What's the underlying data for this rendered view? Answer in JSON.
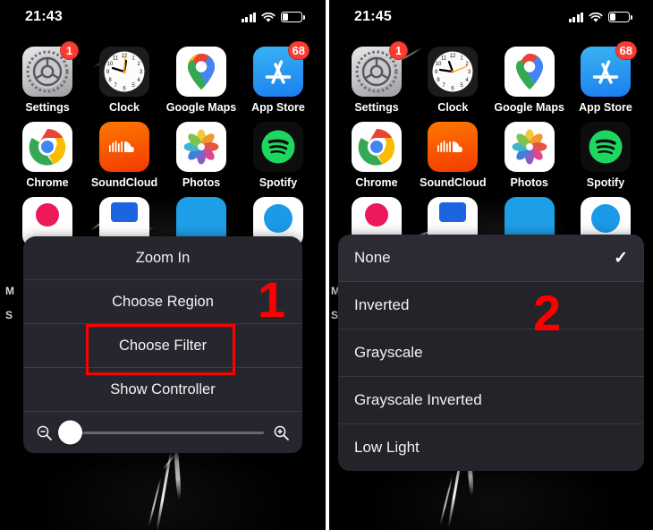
{
  "panels": [
    {
      "id": "left",
      "status": {
        "time": "21:43",
        "cellular_icon": "cellular-bars-icon",
        "wifi_icon": "wifi-icon",
        "battery_icon": "battery-low-icon"
      },
      "apps_row1": [
        {
          "label": "Settings",
          "icon": "settings-gear-icon",
          "badge": "1"
        },
        {
          "label": "Clock",
          "icon": "clock-icon",
          "badge": ""
        },
        {
          "label": "Google Maps",
          "icon": "google-maps-pin-icon",
          "badge": ""
        },
        {
          "label": "App Store",
          "icon": "app-store-icon",
          "badge": "68"
        }
      ],
      "apps_row2": [
        {
          "label": "Chrome",
          "icon": "chrome-icon",
          "badge": ""
        },
        {
          "label": "SoundCloud",
          "icon": "soundcloud-icon",
          "badge": ""
        },
        {
          "label": "Photos",
          "icon": "photos-icon",
          "badge": ""
        },
        {
          "label": "Spotify",
          "icon": "spotify-icon",
          "badge": ""
        }
      ],
      "peek_labels": [
        "M",
        "S"
      ],
      "menu": {
        "items": [
          {
            "label": "Zoom In",
            "highlighted": false
          },
          {
            "label": "Choose Region",
            "highlighted": false
          },
          {
            "label": "Choose Filter",
            "highlighted": true
          },
          {
            "label": "Show Controller",
            "highlighted": false
          }
        ],
        "slider": {
          "zoom_out_icon": "magnifier-minus-icon",
          "zoom_in_icon": "magnifier-plus-icon",
          "value_percent": 0
        }
      },
      "annotation": {
        "number": "1",
        "color": "#ff0000"
      }
    },
    {
      "id": "right",
      "status": {
        "time": "21:45",
        "cellular_icon": "cellular-bars-icon",
        "wifi_icon": "wifi-icon",
        "battery_icon": "battery-low-icon"
      },
      "apps_row1": [
        {
          "label": "Settings",
          "icon": "settings-gear-icon",
          "badge": "1"
        },
        {
          "label": "Clock",
          "icon": "clock-icon",
          "badge": ""
        },
        {
          "label": "Google Maps",
          "icon": "google-maps-pin-icon",
          "badge": ""
        },
        {
          "label": "App Store",
          "icon": "app-store-icon",
          "badge": "68"
        }
      ],
      "apps_row2": [
        {
          "label": "Chrome",
          "icon": "chrome-icon",
          "badge": ""
        },
        {
          "label": "SoundCloud",
          "icon": "soundcloud-icon",
          "badge": ""
        },
        {
          "label": "Photos",
          "icon": "photos-icon",
          "badge": ""
        },
        {
          "label": "Spotify",
          "icon": "spotify-icon",
          "badge": ""
        }
      ],
      "peek_labels": [
        "M",
        "S"
      ],
      "filter_menu": {
        "items": [
          {
            "label": "None",
            "selected": true,
            "check": "✓"
          },
          {
            "label": "Inverted",
            "selected": false,
            "check": ""
          },
          {
            "label": "Grayscale",
            "selected": false,
            "check": ""
          },
          {
            "label": "Grayscale Inverted",
            "selected": false,
            "check": ""
          },
          {
            "label": "Low Light",
            "selected": false,
            "check": ""
          }
        ]
      },
      "annotation": {
        "number": "2",
        "color": "#ff0000"
      }
    }
  ],
  "theme": {
    "badge_red": "#ff3b30",
    "annotation_red": "#ff0000",
    "sheet_bg_left": "#26262e",
    "sheet_bg_right": "#232329",
    "sheet_bg_selected": "#2a2b33"
  }
}
